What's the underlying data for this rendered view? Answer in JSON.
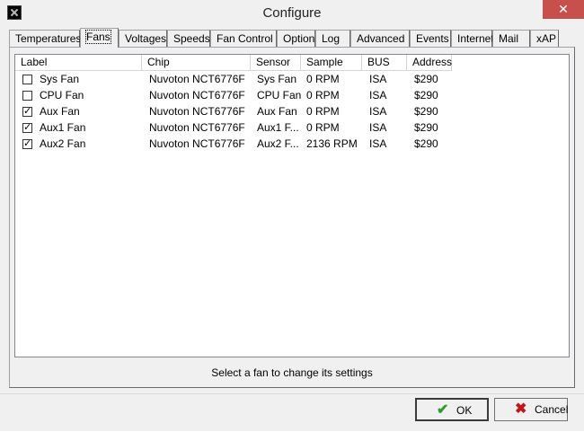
{
  "window": {
    "title": "Configure",
    "close_glyph": "✕"
  },
  "tabs": [
    {
      "label": "Temperatures"
    },
    {
      "label": "Fans"
    },
    {
      "label": "Voltages"
    },
    {
      "label": "Speeds"
    },
    {
      "label": "Fan Control"
    },
    {
      "label": "Options"
    },
    {
      "label": "Log"
    },
    {
      "label": "Advanced"
    },
    {
      "label": "Events"
    },
    {
      "label": "Internet"
    },
    {
      "label": "Mail"
    },
    {
      "label": "xAP"
    }
  ],
  "active_tab": "Fans",
  "list": {
    "columns": [
      "Label",
      "Chip",
      "Sensor",
      "Sample",
      "BUS",
      "Address"
    ],
    "rows": [
      {
        "checked": false,
        "label": "Sys Fan",
        "chip": "Nuvoton NCT6776F",
        "sensor": "Sys Fan",
        "sample": "0 RPM",
        "bus": "ISA",
        "address": "$290"
      },
      {
        "checked": false,
        "label": "CPU Fan",
        "chip": "Nuvoton NCT6776F",
        "sensor": "CPU Fan",
        "sample": "0 RPM",
        "bus": "ISA",
        "address": "$290"
      },
      {
        "checked": true,
        "label": "Aux Fan",
        "chip": "Nuvoton NCT6776F",
        "sensor": "Aux Fan",
        "sample": "0 RPM",
        "bus": "ISA",
        "address": "$290"
      },
      {
        "checked": true,
        "label": "Aux1 Fan",
        "chip": "Nuvoton NCT6776F",
        "sensor": "Aux1 F...",
        "sample": "0 RPM",
        "bus": "ISA",
        "address": "$290"
      },
      {
        "checked": true,
        "label": "Aux2 Fan",
        "chip": "Nuvoton NCT6776F",
        "sensor": "Aux2 F...",
        "sample": "2136 RPM",
        "bus": "ISA",
        "address": "$290"
      }
    ]
  },
  "hint_text": "Select a fan to change its settings",
  "buttons": {
    "ok": {
      "label": "OK",
      "icon": "checkmark-icon",
      "color": "#2e9a2e"
    },
    "cancel": {
      "label": "Cancel",
      "icon": "x-icon",
      "color": "#c0161b"
    }
  }
}
